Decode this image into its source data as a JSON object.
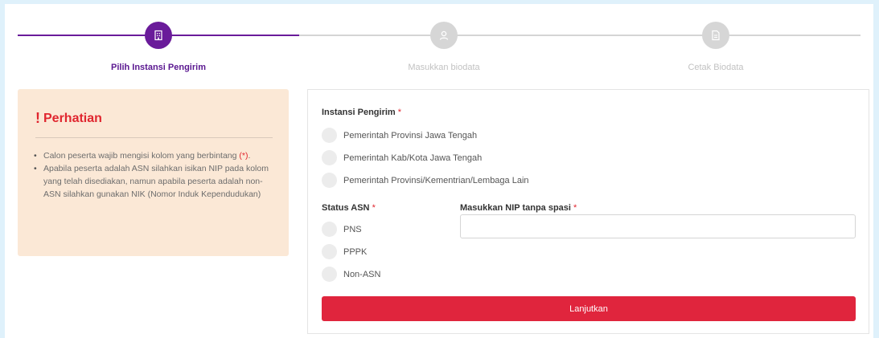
{
  "stepper": {
    "steps": [
      {
        "label": "Pilih Instansi Pengirim",
        "icon": "building-icon",
        "state": "active"
      },
      {
        "label": "Masukkan biodata",
        "icon": "user-icon",
        "state": "inactive"
      },
      {
        "label": "Cetak Biodata",
        "icon": "document-icon",
        "state": "inactive"
      }
    ]
  },
  "notice": {
    "icon": "!",
    "title": "Perhatian",
    "items": [
      {
        "text_before": "Calon peserta wajib mengisi kolom yang berbintang ",
        "required_mark": "(*)",
        "text_after": "."
      },
      {
        "text": "Apabila peserta adalah ASN silahkan isikan NIP pada kolom yang telah disediakan, namun apabila peserta adalah non-ASN silahkan gunakan NIK (Nomor Induk Kependudukan)"
      }
    ]
  },
  "form": {
    "instansi": {
      "label": "Instansi Pengirim",
      "required": "*",
      "options": [
        "Pemerintah Provinsi Jawa Tengah",
        "Pemerintah Kab/Kota Jawa Tengah",
        "Pemerintah Provinsi/Kementrian/Lembaga Lain"
      ]
    },
    "status_asn": {
      "label": "Status ASN",
      "required": "*",
      "options": [
        "PNS",
        "PPPK",
        "Non-ASN"
      ]
    },
    "nip": {
      "label": "Masukkan NIP tanpa spasi",
      "required": "*",
      "value": "",
      "placeholder": ""
    },
    "submit_label": "Lanjutkan"
  },
  "colors": {
    "primary_purple": "#6a1b9a",
    "accent_red": "#e0253d",
    "notice_bg": "#fbe8d6",
    "page_bg": "#dff1fb"
  }
}
